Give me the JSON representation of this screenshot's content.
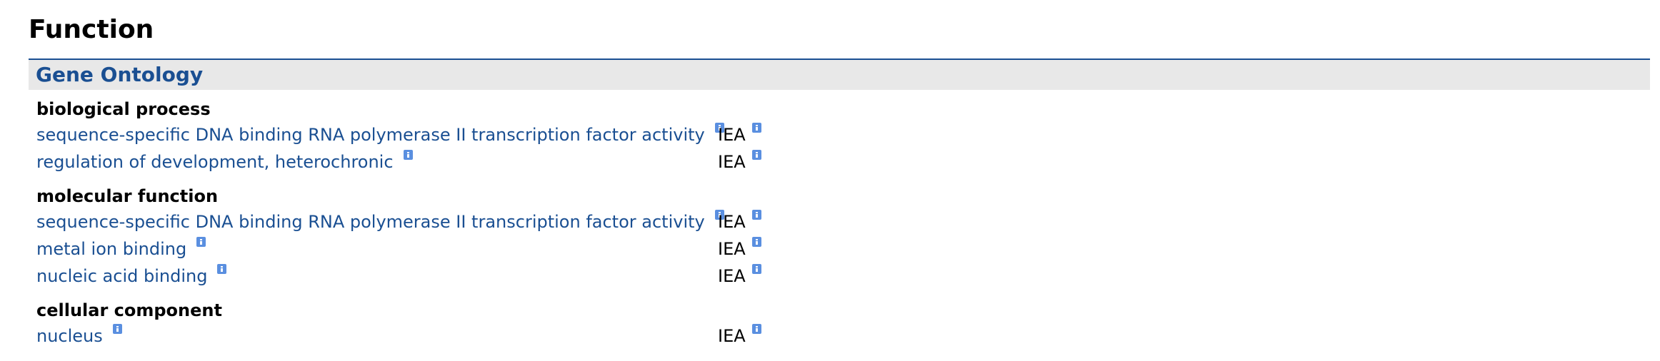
{
  "section": {
    "title": "Function"
  },
  "panel": {
    "title": "Gene Ontology"
  },
  "icons": {
    "info": "info-icon",
    "icon_color": "#5a8fe0"
  },
  "colors": {
    "link": "#1a4f92",
    "rule": "#1a4f92",
    "subheader_bg": "#e8e8e8"
  },
  "categories": [
    {
      "label": "biological process",
      "terms": [
        {
          "term": "sequence-specific DNA binding RNA polymerase II transcription factor activity",
          "evidence": "IEA"
        },
        {
          "term": "regulation of development, heterochronic",
          "evidence": "IEA"
        }
      ]
    },
    {
      "label": "molecular function",
      "terms": [
        {
          "term": "sequence-specific DNA binding RNA polymerase II transcription factor activity",
          "evidence": "IEA"
        },
        {
          "term": "metal ion binding",
          "evidence": "IEA"
        },
        {
          "term": "nucleic acid binding",
          "evidence": "IEA"
        }
      ]
    },
    {
      "label": "cellular component",
      "terms": [
        {
          "term": "nucleus",
          "evidence": "IEA"
        }
      ]
    }
  ]
}
